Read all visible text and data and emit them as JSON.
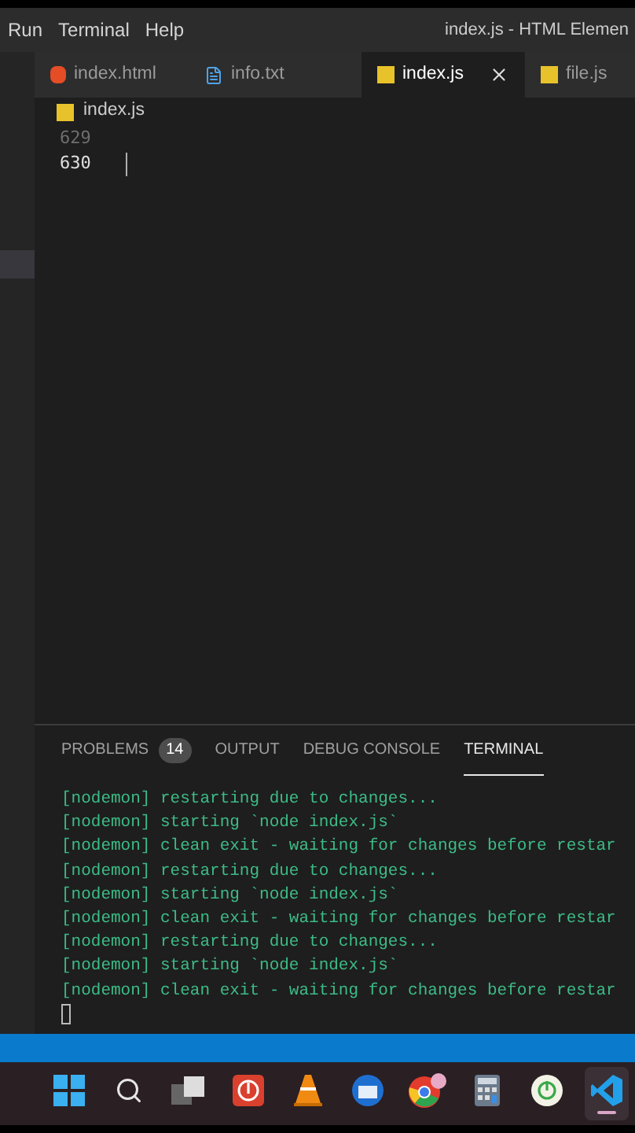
{
  "menu": [
    {
      "label": "Run"
    },
    {
      "label": "Terminal"
    },
    {
      "label": "Help"
    }
  ],
  "window": {
    "title": "index.js - HTML Elemen"
  },
  "tabs": [
    {
      "label": "index.html",
      "kind": "html",
      "selected": false
    },
    {
      "label": "info.txt",
      "kind": "txt",
      "selected": false
    },
    {
      "label": "index.js",
      "kind": "js",
      "selected": true
    },
    {
      "label": "file.js",
      "kind": "js",
      "selected": false
    }
  ],
  "breadcrumb": {
    "label": "index.js",
    "kind": "js"
  },
  "editor": {
    "lines": [
      {
        "number": "629",
        "active": false
      },
      {
        "number": "630",
        "active": true
      }
    ]
  },
  "panel": {
    "tabs": [
      {
        "label": "PROBLEMS",
        "badge": "14",
        "selected": false
      },
      {
        "label": "OUTPUT",
        "selected": false
      },
      {
        "label": "DEBUG CONSOLE",
        "selected": false
      },
      {
        "label": "TERMINAL",
        "selected": true
      }
    ],
    "terminal": [
      "[nodemon] restarting due to changes...",
      "[nodemon] starting `node index.js`",
      "[nodemon] clean exit - waiting for changes before restar",
      "[nodemon] restarting due to changes...",
      "[nodemon] starting `node index.js`",
      "[nodemon] clean exit - waiting for changes before restar",
      "[nodemon] restarting due to changes...",
      "[nodemon] starting `node index.js`",
      "[nodemon] clean exit - waiting for changes before restar"
    ]
  },
  "taskbar": [
    {
      "kind": "start",
      "selected": false
    },
    {
      "kind": "search",
      "selected": false
    },
    {
      "kind": "taskview",
      "selected": false
    },
    {
      "kind": "power",
      "selected": false
    },
    {
      "kind": "cone",
      "selected": false
    },
    {
      "kind": "mail",
      "selected": false
    },
    {
      "kind": "browser",
      "selected": false
    },
    {
      "kind": "calculator",
      "selected": false
    },
    {
      "kind": "clock",
      "selected": false
    },
    {
      "kind": "code",
      "selected": true
    }
  ]
}
